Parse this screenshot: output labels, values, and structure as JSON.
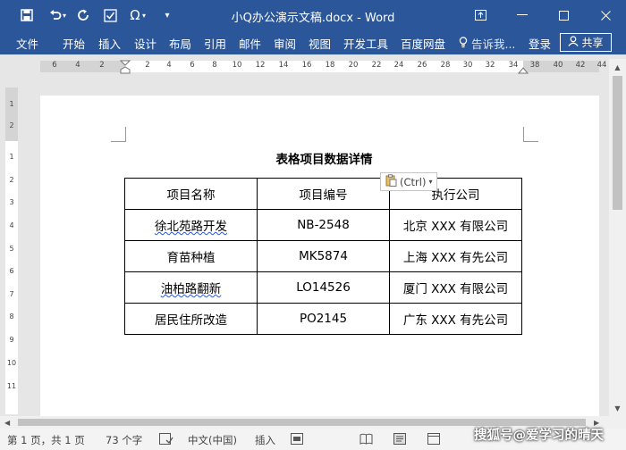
{
  "window": {
    "title": "小Q办公演示文稿.docx - Word"
  },
  "quick_access": [
    "save-icon",
    "undo-icon",
    "redo-icon",
    "spellcheck-icon",
    "omega-icon",
    "customize-icon"
  ],
  "ribbon": {
    "tabs": [
      "文件",
      "开始",
      "插入",
      "设计",
      "布局",
      "引用",
      "邮件",
      "审阅",
      "视图",
      "开发工具",
      "百度网盘"
    ],
    "tell_me": "告诉我...",
    "login": "登录",
    "share": "共享"
  },
  "ruler": {
    "h_labels": [
      "6",
      "4",
      "2",
      "2",
      "4",
      "6",
      "8",
      "10",
      "12",
      "14",
      "16",
      "18",
      "20",
      "22",
      "24",
      "26",
      "28",
      "30",
      "32",
      "34",
      "38",
      "40",
      "42",
      "44",
      "46",
      "48"
    ],
    "v_labels": [
      "1",
      "2",
      "1",
      "2",
      "3",
      "4",
      "5",
      "6",
      "7",
      "8",
      "9",
      "10",
      "11"
    ]
  },
  "document": {
    "title": "表格项目数据详情",
    "table": {
      "headers": [
        "项目名称",
        "项目编号",
        "执行公司"
      ],
      "rows": [
        [
          "徐北苑路开发",
          "NB-2548",
          "北京 XXX 有限公司"
        ],
        [
          "育苗种植",
          "MK5874",
          "上海 XXX 有先公司"
        ],
        [
          "油柏路翻新",
          "LO14526",
          "厦门 XXX 有限公司"
        ],
        [
          "居民住所改造",
          "PO2145",
          "广东 XXX 有先公司"
        ]
      ]
    },
    "paste_options": "(Ctrl)"
  },
  "status": {
    "page": "第 1 页，共 1 页",
    "words": "73 个字",
    "language": "中文(中国)",
    "mode": "插入"
  },
  "watermark": "搜狐号@爱学习的晴天",
  "colors": {
    "brand": "#2b579a",
    "spell_squiggle": "#2b56d6"
  }
}
